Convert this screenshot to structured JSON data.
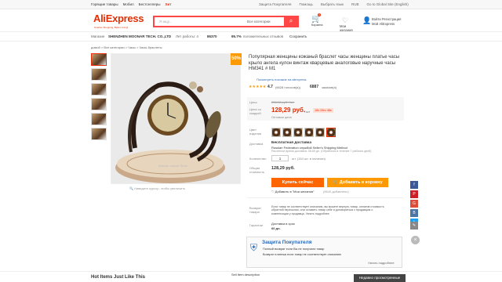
{
  "topbar": {
    "left": [
      "Горящие товары",
      "Мобил",
      "Бестселлеры"
    ],
    "logo": "Хит",
    "right": [
      "Защита Покупателя",
      "Помощь",
      "Выбрать язык",
      "RUB",
      "Go to Global Site (English)"
    ]
  },
  "header": {
    "logo": "AliExpress",
    "logo_sub": "Smarter Shopping, Better Living!",
    "search_placeholder": "Я ищу...",
    "search_category": "Все категории",
    "cart_count": "0",
    "cart_label": "Корзина",
    "wish_label": "Мои желания",
    "account_line1": "Войти  Регистрация",
    "account_line2": "Мой AliExpress"
  },
  "store": {
    "label": "Магазин",
    "name": "SHENZHEN MOONAR TECH. CO.,LTD",
    "years": "Лет работы: 4",
    "rating": "86370",
    "positive": "95.7%",
    "positive_label": "положительных отзывов",
    "save": "Сохранить"
  },
  "breadcrumb": "домой > Все категории > Часы > Часы-браслеты",
  "product": {
    "discount": "50%",
    "title": "Популярная женщины кожаный браслет часы женщины платье часы крыло ангела кулон винтаж кварцевые аналоговые наручные часы HM341 # M1",
    "compare": "Посмотреть похожие на aliexpress",
    "rating": "4.7",
    "reviews": "(6628 голосов(а))",
    "orders": "6887",
    "orders_label": "заказов(а)",
    "zoom_hint": "Наведите курсор, чтобы увеличить",
    "watch_watermark": "Marcon mouse Store"
  },
  "pricing": {
    "price_label": "Цена",
    "old_price": "256.16 руб. / шт",
    "sale_label": "Цена со скидкой",
    "sale_price": "128,29 руб.",
    "unit": "/ шт",
    "timer": "18ч 28m 48s",
    "wholesale": "Оптовая цена"
  },
  "options": {
    "color_label": "Цвет изделия",
    "delivery_label": "Доставка",
    "free_delivery": "Бесплатная доставка",
    "ship_to": "Russian Federation службой Seller's Shipping Method",
    "ship_eta": "Расчетное время доставки: 38-65 дн. (Обработка в течение 7 рабочих дней)",
    "qty_label": "Количество",
    "qty": "1",
    "qty_hint": "шт. (154 шт. в наличии)",
    "total_label": "Общая стоимость",
    "total": "128,29 руб."
  },
  "actions": {
    "buy": "Купить сейчас",
    "add_cart": "Добавить в корзину",
    "wishlist": "Добавить в \"Мои желания\"",
    "wish_count": "(6640 добавлено)"
  },
  "returns": {
    "label": "Возврат товара",
    "text": "Если товар не соответствует описанию, вы можете вернуть товар, оплатив стоимость обратной пересылки, или оставить товар себе и договориться с продавцом о компенсации у продавца. Узнать подробнее",
    "guarantee_label": "Гарантии",
    "guarantee": "Доставка в срок",
    "days": "60 дн."
  },
  "protection": {
    "title": "Защита Покупателя",
    "line1": "Полный возврат если Вы не получили товар",
    "line2": "Возврат платежа если товар не соответствует описанию",
    "more": "Узнать подробнее"
  },
  "footer": {
    "related": "Hot Items Just Like This",
    "sell_link": "Sell Item description",
    "recent": "Недавно просмотренные"
  }
}
